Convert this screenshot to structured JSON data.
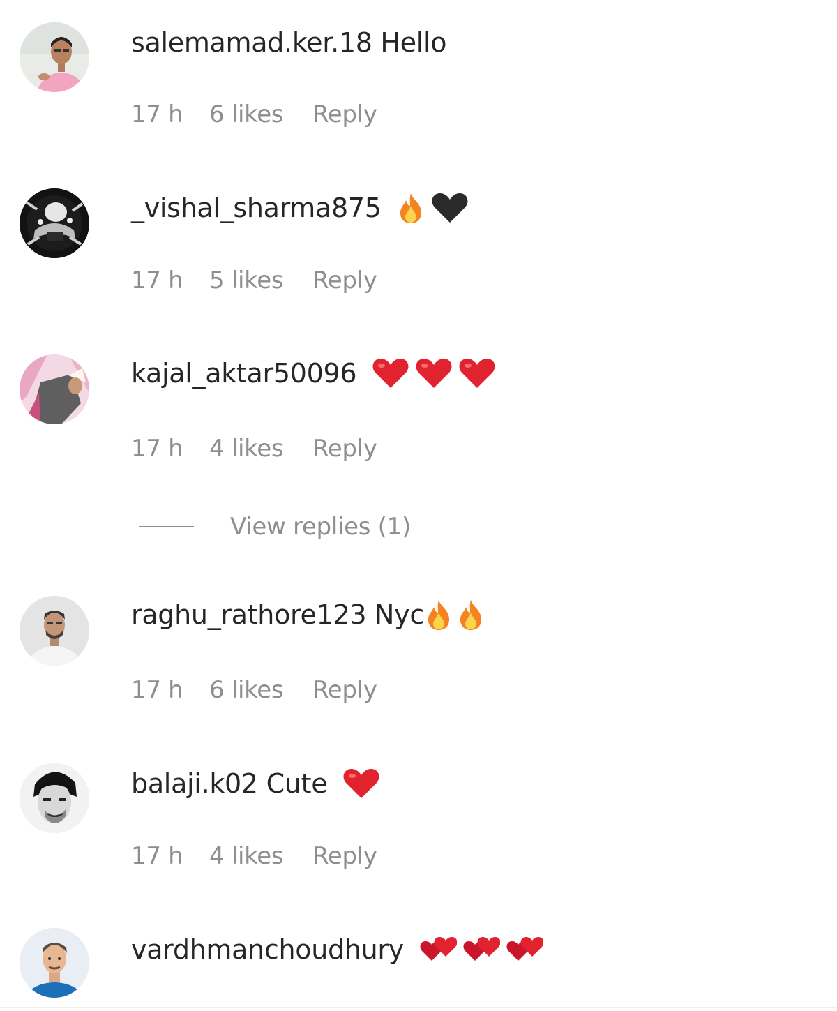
{
  "comments": [
    {
      "username": "salemamad.ker.18",
      "text": "Hello",
      "emojis": [],
      "time": "17 h",
      "likes": "6 likes",
      "reply_label": "Reply",
      "avatar_icon": "avatar-man-pink-shirt"
    },
    {
      "username": "_vishal_sharma875",
      "text": "",
      "emojis": [
        "fire",
        "black-heart"
      ],
      "time": "17 h",
      "likes": "5 likes",
      "reply_label": "Reply",
      "avatar_icon": "avatar-dark-bw"
    },
    {
      "username": "kajal_aktar50096",
      "text": "",
      "emojis": [
        "red-heart",
        "red-heart",
        "red-heart"
      ],
      "time": "17 h",
      "likes": "4 likes",
      "reply_label": "Reply",
      "avatar_icon": "avatar-pink-fabric"
    },
    {
      "username": "raghu_rathore123",
      "text": "Nyc",
      "emojis": [
        "fire",
        "fire"
      ],
      "time": "17 h",
      "likes": "6 likes",
      "reply_label": "Reply",
      "avatar_icon": "avatar-man-light"
    },
    {
      "username": "balaji.k02",
      "text": "Cute",
      "emojis": [
        "red-heart"
      ],
      "time": "17 h",
      "likes": "4 likes",
      "reply_label": "Reply",
      "avatar_icon": "avatar-man-bw"
    },
    {
      "username": "vardhmanchoudhury",
      "text": "",
      "emojis": [
        "two-hearts",
        "two-hearts",
        "two-hearts"
      ],
      "avatar_icon": "avatar-man-blue-bg"
    }
  ],
  "view_replies": {
    "label": "View replies (1)"
  },
  "colors": {
    "username": "#262626",
    "meta": "#8e8e8e",
    "heart": "#e0232e",
    "fire_outer": "#f5831f",
    "fire_inner": "#fcd34d",
    "black_heart": "#2b2b2b"
  }
}
